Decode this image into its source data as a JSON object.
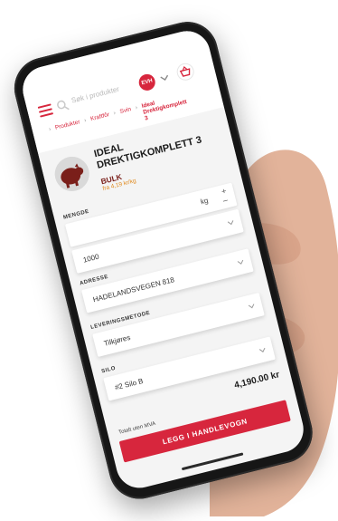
{
  "header": {
    "search_placeholder": "Søk i produkter",
    "avatar_initials": "EVH",
    "cart_icon": "basket-icon",
    "menu_icon": "hamburger-icon"
  },
  "breadcrumb": {
    "items": [
      "Produkter",
      "Kraftfôr",
      "Svin"
    ],
    "current": "Ideal Drektigkomplett 3"
  },
  "product": {
    "title": "IDEAL DREKTIGKOMPLETT 3",
    "unit": "BULK",
    "price_per": "fra 4,19 kr/kg"
  },
  "quantity": {
    "label": "MENGDE",
    "value": "1000",
    "unit": "kg",
    "plus": "+",
    "minus": "–"
  },
  "address": {
    "label": "ADRESSE",
    "value": "HADELANDSVEGEN 818"
  },
  "delivery": {
    "label": "LEVERINGSMETODE",
    "value": "Tilkjøres"
  },
  "silo": {
    "label": "SILO",
    "value": "#2 Silo B"
  },
  "total": {
    "amount": "4,190.00 kr",
    "note": "Totalt uten MVA"
  },
  "cta": {
    "label": "LEGG I HANDLEVOGN"
  },
  "colors": {
    "accent": "#d7263d",
    "unit_brown": "#7a1f1a",
    "price_orange": "#e08a1e"
  }
}
